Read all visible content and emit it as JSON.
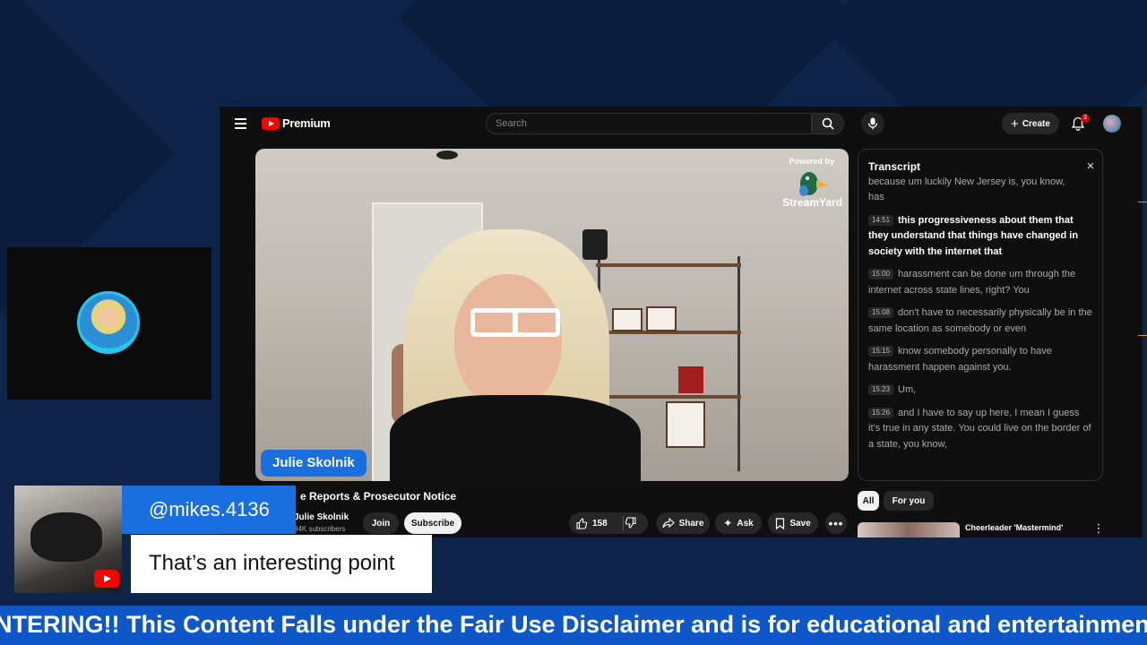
{
  "header": {
    "logo_text": "Premium",
    "search_placeholder": "Search",
    "create_label": "Create",
    "notification_count": "3"
  },
  "video": {
    "powered_by": "Powered by",
    "brand": "StreamYard",
    "speaker_name": "Julie Skolnik",
    "title": "e Reports & Prosecutor Notice",
    "channel_name": "Julie Skolnik",
    "subscriber_count": "94K subscribers",
    "join_label": "Join",
    "subscribe_label": "Subscribe",
    "like_count": "158",
    "share_label": "Share",
    "ask_label": "Ask",
    "save_label": "Save"
  },
  "transcript": {
    "title": "Transcript",
    "segments": [
      {
        "time": "",
        "text": "because um luckily New Jersey is, you know,"
      },
      {
        "time": "",
        "text": "has"
      },
      {
        "time": "14:51",
        "text": "this progressiveness about them that they understand that things have changed in society with the internet that"
      },
      {
        "time": "15:00",
        "text": "harassment can be done um through the internet across state lines, right? You"
      },
      {
        "time": "15:08",
        "text": "don't have to necessarily physically be in the same location as somebody or even"
      },
      {
        "time": "15:15",
        "text": "know somebody personally to have harassment happen against you."
      },
      {
        "time": "15:23",
        "text": "Um,"
      },
      {
        "time": "15:26",
        "text": "and I have to say up here, I mean I guess it's true in any state. You could live on the border of a state, you know,"
      }
    ]
  },
  "sidebar": {
    "chip_all": "All",
    "chip_for_you": "For you",
    "rec_title": "Cheerleader 'Mastermind'"
  },
  "overlay": {
    "comment_username": "@mikes.4136",
    "comment_text": "That’s an interesting point",
    "ticker_text": "NTERING!! This Content Falls under the Fair Use Disclaimer and is for educational and entertainment purpos"
  },
  "colors": {
    "page_bg": "#0d2347",
    "accent_blue": "#1a6fe0",
    "youtube_red": "#ff0000",
    "ticker_blue": "#0e57c9"
  }
}
